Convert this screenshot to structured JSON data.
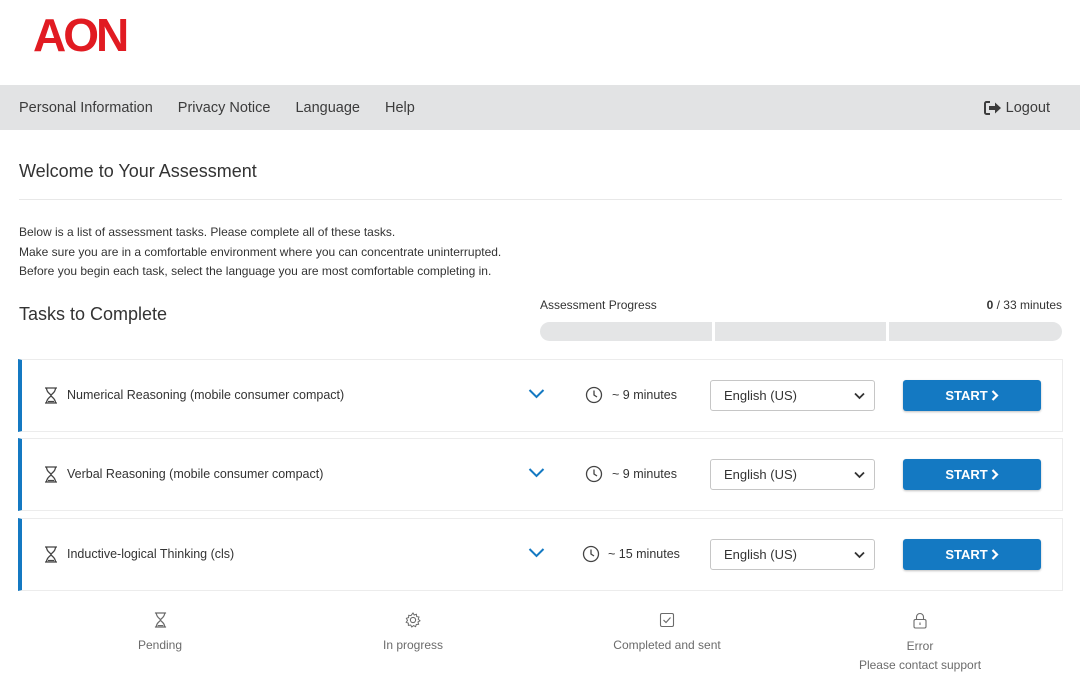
{
  "brand": {
    "logo_text": "AON",
    "color": "#e11b22"
  },
  "nav": {
    "items": [
      "Personal Information",
      "Privacy Notice",
      "Language",
      "Help"
    ],
    "logout_label": "Logout"
  },
  "page": {
    "title": "Welcome to Your Assessment",
    "intro": [
      "Below is a list of assessment tasks. Please complete all of these tasks.",
      "Make sure you are in a comfortable environment where you can concentrate uninterrupted.",
      "Before you begin each task, select the language you are most comfortable completing in."
    ],
    "tasks_heading": "Tasks to Complete"
  },
  "progress": {
    "label": "Assessment Progress",
    "completed": "0",
    "total_text": "/ 33 minutes",
    "segments_filled": [
      0,
      0,
      0
    ]
  },
  "tasks": [
    {
      "name": "Numerical Reasoning (mobile consumer compact)",
      "duration": "~ 9 minutes",
      "language": "English (US)",
      "start_label": "START"
    },
    {
      "name": "Verbal Reasoning (mobile consumer compact)",
      "duration": "~ 9 minutes",
      "language": "English (US)",
      "start_label": "START"
    },
    {
      "name": "Inductive-logical Thinking (cls)",
      "duration": "~ 15 minutes",
      "language": "English (US)",
      "start_label": "START"
    }
  ],
  "legend": {
    "pending": "Pending",
    "in_progress": "In progress",
    "completed": "Completed and sent",
    "error_line1": "Error",
    "error_line2": "Please contact support"
  },
  "colors": {
    "accent": "#1479c2",
    "nav_bg": "#e2e3e4",
    "progress_track": "#e4e5e6"
  },
  "icons": [
    "hourglass-icon",
    "clock-icon",
    "chevron-down-icon",
    "logout-icon",
    "gear-icon",
    "checkbox-icon",
    "lock-icon"
  ]
}
